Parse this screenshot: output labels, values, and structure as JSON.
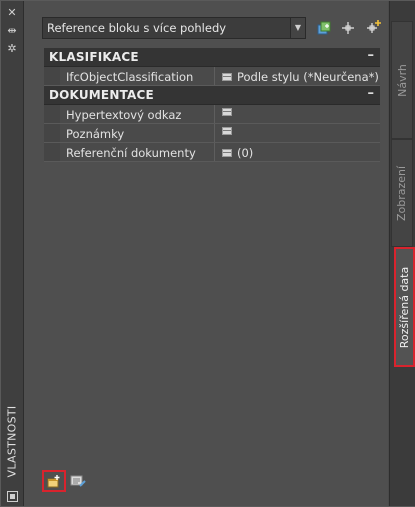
{
  "palette": {
    "title": "VLASTNOSTI",
    "strip_icons": [
      "close-icon",
      "auto-hide-icon",
      "settings-icon",
      "properties-menu-icon"
    ]
  },
  "dropdown": {
    "value": "Reference bloku s více pohledy"
  },
  "toolbar": {
    "buttons": [
      "quick-select-icon",
      "select-objects-icon",
      "toggle-pickadd-icon"
    ]
  },
  "sections": [
    {
      "title": "KLASIFIKACE",
      "toggle": "–",
      "rows": [
        {
          "label": "IfcObjectClassification",
          "value": "Podle stylu (*Neurčena*)",
          "has_icon": true
        }
      ]
    },
    {
      "title": "DOKUMENTACE",
      "toggle": "–",
      "rows": [
        {
          "label": "Hypertextový odkaz",
          "value": "",
          "has_icon": true
        },
        {
          "label": "Poznámky",
          "value": "",
          "has_icon": true
        },
        {
          "label": "Referenční dokumenty",
          "value": "(0)",
          "has_icon": true
        }
      ]
    }
  ],
  "tabs": [
    {
      "label": "Návrh",
      "active": false,
      "highlight": false
    },
    {
      "label": "Zobrazení",
      "active": false,
      "highlight": false
    },
    {
      "label": "Rozšířená data",
      "active": true,
      "highlight": true
    }
  ],
  "bottom_buttons": [
    {
      "name": "property-sets-icon",
      "highlight": true
    },
    {
      "name": "edit-data-icon",
      "highlight": false
    }
  ],
  "colors": {
    "highlight": "#d9232d",
    "background": "#4f4f4f",
    "header": "#343434"
  }
}
